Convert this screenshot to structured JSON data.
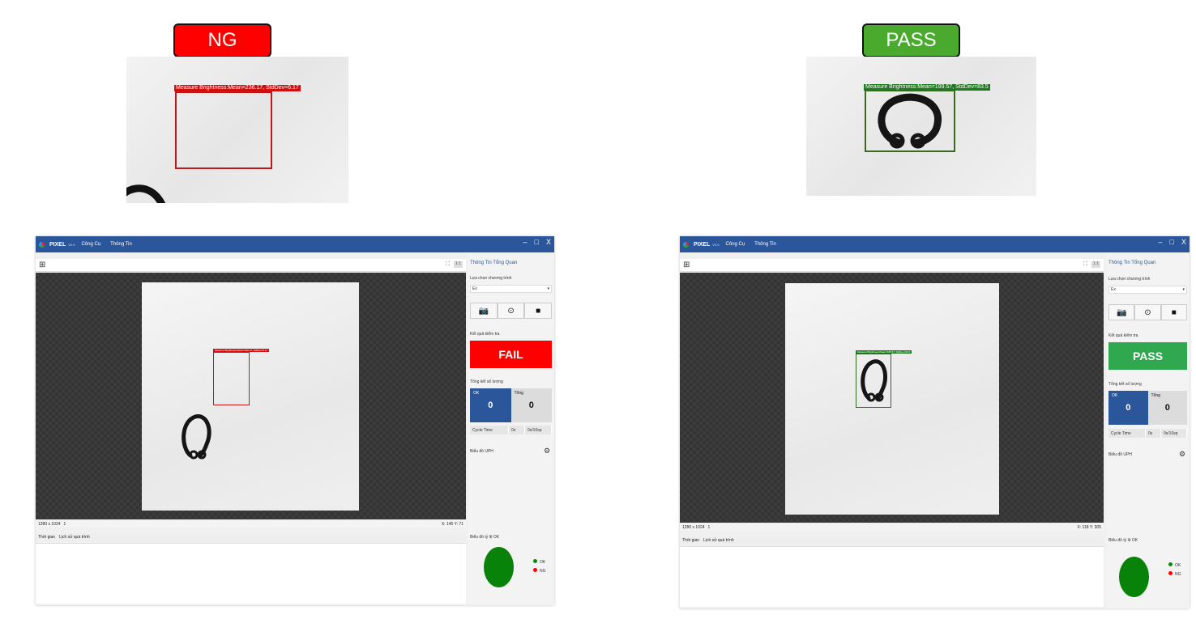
{
  "labels": {
    "ng": "NG",
    "pass": "PASS"
  },
  "crops": {
    "ng_caption": "Measure Brightness:Mean=236.17, StdDev=6.17",
    "pass_caption": "Measure Brightness:Mean=189.57, StdDev=83.5"
  },
  "app": {
    "brand": "PIXEL",
    "version": "V2.0",
    "menu": [
      "Công Cụ",
      "Thông Tin"
    ],
    "window_min": "–",
    "window_max": "□",
    "window_close": "X",
    "zoom_label": "1:1",
    "expand_icon": "⛶",
    "add_icon": "⊞",
    "tabs": [
      "Thời gian",
      "Lịch sử quá trình"
    ],
    "panel": {
      "title": "Thông Tin Tổng Quan",
      "program_label": "Lựa chọn chương trình",
      "program_value": "Ex",
      "result_label": "Kết quả kiểm tra",
      "summary_label": "Tổng kết số lượng",
      "ok_label": "OK",
      "total_label": "Tổng",
      "cycle_label": "Cycle Time",
      "cycle_time": "0s",
      "cycle_rate": "0s/10sp",
      "uph_label": "Biểu đồ UPH",
      "ratio_label": "Biểu đồ tỷ lệ OK",
      "legend_ok": "OK",
      "legend_ng": "NG"
    },
    "resolution": "1280 x 1024",
    "cam_index": "1"
  },
  "left_window": {
    "result": "FAIL",
    "ok_count": "0",
    "total_count": "0",
    "coords": "X: 145 Y: 71",
    "roi_caption": "Measure Brightness:Mean=236.17, StdDev=6.17"
  },
  "right_window": {
    "result": "PASS",
    "ok_count": "0",
    "total_count": "0",
    "coords": "X: 118 Y: 305",
    "roi_caption": "Measure Brightness:Mean=189.57, StdDev=83.5"
  },
  "colors": {
    "fail": "#ff0000",
    "pass": "#2fa84f",
    "titlebar": "#2b579a",
    "ok_count_bg": "#2b579a",
    "pie_ok": "#088208",
    "legend_ok": "#0a8a0a",
    "legend_ng": "#ff0000"
  }
}
